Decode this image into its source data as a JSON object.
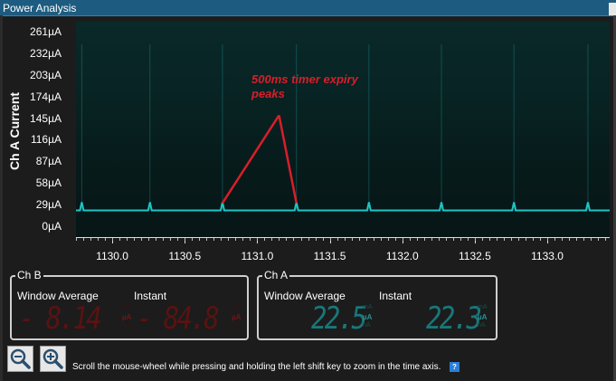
{
  "window": {
    "title": "Power Analysis"
  },
  "chart_data": {
    "type": "line",
    "ylabel": "Ch A Current",
    "y_ticks": [
      "261µA",
      "232µA",
      "203µA",
      "174µA",
      "145µA",
      "116µA",
      "87µA",
      "58µA",
      "29µA",
      "0µA"
    ],
    "ylim": [
      -14,
      276
    ],
    "x_ticks": [
      "1130.0",
      "1130.5",
      "1131.0",
      "1131.5",
      "1132.0",
      "1132.5",
      "1133.0"
    ],
    "xlim": [
      1129.75,
      1133.43
    ],
    "baseline_uA": 22,
    "spike_uA": 33,
    "spike_times": [
      1129.79,
      1130.26,
      1130.76,
      1131.27,
      1131.77,
      1132.27,
      1132.77,
      1133.28
    ],
    "series": [
      {
        "color": "#1fc4c4"
      }
    ],
    "annotation": {
      "line1": "500ms timer expiry",
      "line2": "peaks",
      "apex_x": 1131.15,
      "apex_y": 150,
      "color": "#d81e2a"
    }
  },
  "ch_b": {
    "title": "Ch B",
    "window_average_label": "Window Average",
    "instant_label": "Instant",
    "window_average_value": "- 8.14",
    "instant_value": "- 84.8",
    "unit": "µA"
  },
  "ch_a": {
    "title": "Ch A",
    "window_average_label": "Window Average",
    "instant_label": "Instant",
    "window_average_value": "22.5",
    "instant_value": "22.3",
    "unit": "µA"
  },
  "toolbar": {
    "zoom_out_icon": "zoom-out-icon",
    "zoom_in_icon": "zoom-in-icon",
    "hint": "Scroll the mouse-wheel while pressing and holding the left shift key to zoom in the time axis.",
    "help_label": "?"
  }
}
